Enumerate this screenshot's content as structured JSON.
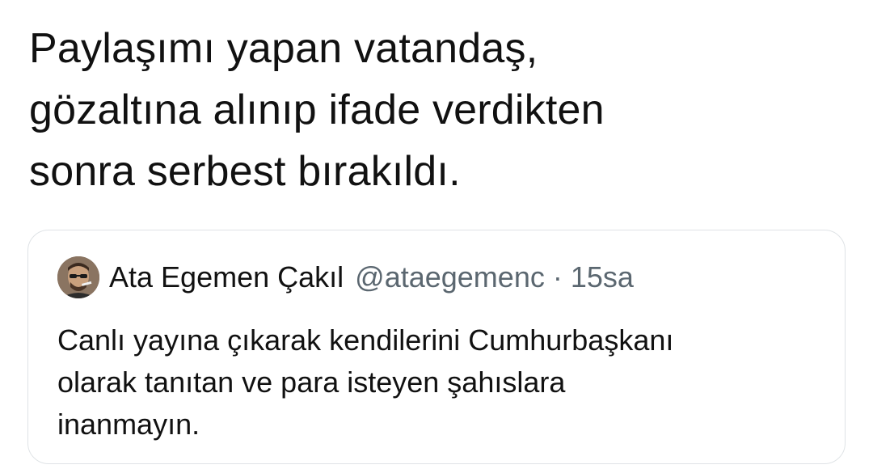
{
  "tweet": {
    "text_lines": [
      "Paylaşımı yapan vatandaş,",
      "gözaltına alınıp ifade verdikten",
      "sonra serbest bırakıldı."
    ]
  },
  "quoted_tweet": {
    "avatar_icon": "user-avatar-icon",
    "author_name": "Ata Egemen Çakıl",
    "author_handle": "@ataegemenc",
    "separator": "·",
    "timestamp": "15sa",
    "text_lines": [
      "Canlı yayına çıkarak kendilerini Cumhurbaşkanı",
      "olarak tanıtan ve para isteyen şahıslara",
      "inanmayın."
    ]
  },
  "colors": {
    "text": "#111111",
    "muted": "#5b6770",
    "border": "#dfe3e6",
    "background": "#ffffff"
  }
}
